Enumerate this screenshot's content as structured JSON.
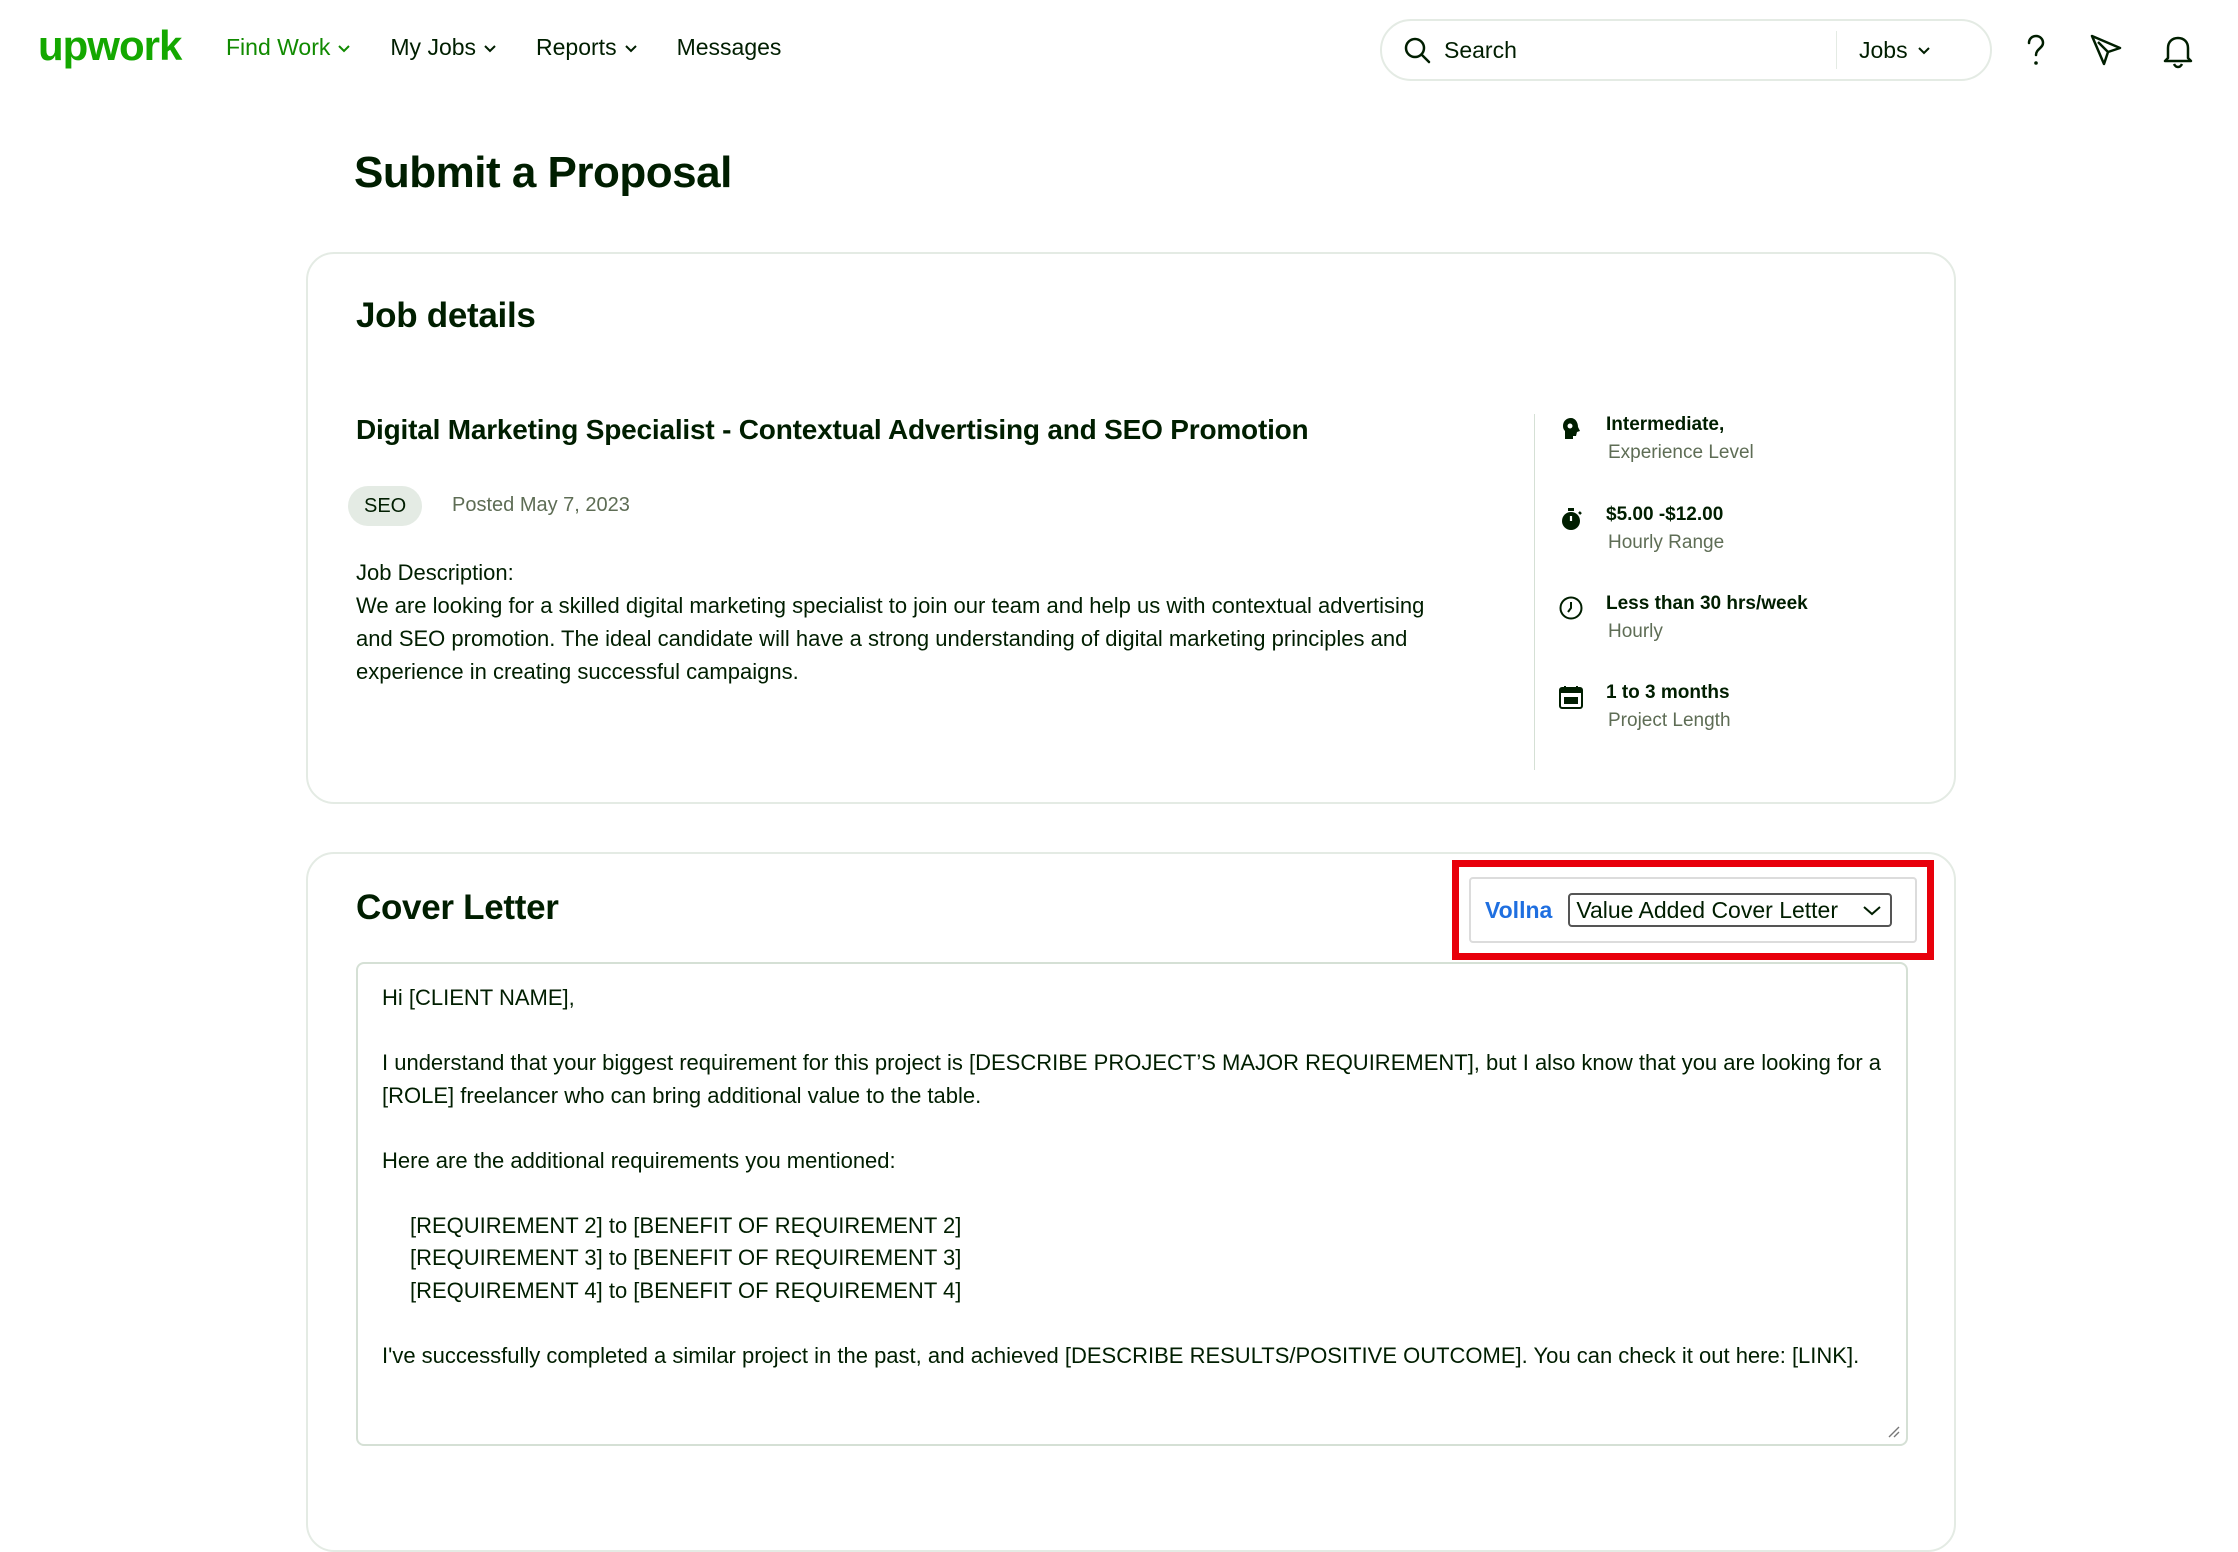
{
  "header": {
    "logo": "upwork",
    "nav": [
      {
        "label": "Find Work",
        "active": true
      },
      {
        "label": "My Jobs"
      },
      {
        "label": "Reports"
      },
      {
        "label": "Messages"
      }
    ],
    "search": {
      "placeholder": "Search",
      "type_label": "Jobs"
    },
    "icons": [
      "help-icon",
      "send-icon",
      "notifications-bell-icon"
    ]
  },
  "page": {
    "title": "Submit a Proposal"
  },
  "job_details": {
    "heading": "Job details",
    "title": "Digital Marketing Specialist - Contextual Advertising and SEO Promotion",
    "tag": "SEO",
    "posted": "Posted May 7, 2023",
    "description_label": "Job Description:",
    "description": "We are looking for a skilled digital marketing specialist to join our team and help us with contextual advertising and SEO promotion. The ideal candidate will have a strong understanding of digital marketing principles and experience in creating successful campaigns.",
    "features": [
      {
        "icon": "experience-level-icon",
        "main": "Intermediate,",
        "sub": "Experience Level"
      },
      {
        "icon": "stopwatch-icon",
        "main": "$5.00 -$12.00",
        "sub": "Hourly Range"
      },
      {
        "icon": "clock-icon",
        "main": "Less than 30 hrs/week",
        "sub": "Hourly"
      },
      {
        "icon": "calendar-icon",
        "main": "1 to 3 months",
        "sub": "Project Length"
      }
    ]
  },
  "cover_letter": {
    "heading": "Cover Letter",
    "vollna": {
      "label": "Vollna",
      "selected": "Value Added Cover Letter",
      "highlight_color": "#e8000b"
    },
    "lines": {
      "greeting": "Hi [CLIENT NAME],",
      "p1": "I understand that your biggest requirement for this project is [DESCRIBE PROJECT’S MAJOR REQUIREMENT], but I also know that you are looking for a [ROLE] freelancer who can bring additional value to the table.",
      "p2": "Here are the additional requirements you mentioned:",
      "req2": "[REQUIREMENT 2] to [BENEFIT OF REQUIREMENT 2]",
      "req3": "[REQUIREMENT 3] to [BENEFIT OF REQUIREMENT 3]",
      "req4": "[REQUIREMENT 4] to [BENEFIT OF REQUIREMENT 4]",
      "p3": "I've successfully completed a similar project in the past, and achieved [DESCRIBE RESULTS/POSITIVE OUTCOME]. You can check it out here: [LINK]."
    }
  },
  "colors": {
    "brand": "#14a800",
    "text": "#001e00",
    "muted": "#5e6d55",
    "border": "#e4ebe4",
    "vollna": "#1f6fe0"
  }
}
